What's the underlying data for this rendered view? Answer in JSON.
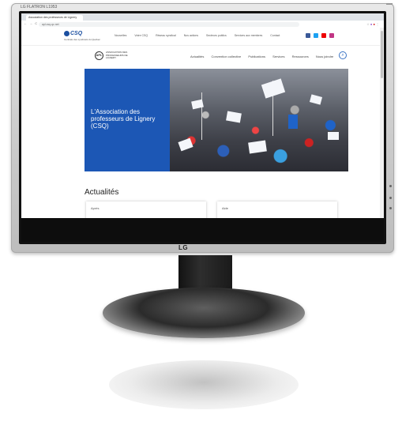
{
  "monitor": {
    "model_label": "LG FLATRON L1953",
    "top_button_label": "",
    "brand": "LG"
  },
  "browser": {
    "tab_title": "Association des professeurs de Lignery",
    "url": "apl.csq.qc.net",
    "nav_icons": "← → C ⌂"
  },
  "csq_bar": {
    "logo_text": "CSQ",
    "sub_text": "Centrale des syndicats du Québec",
    "menu": [
      "Nouvelles",
      "Votre CSQ",
      "Réseau syndical",
      "Nos actions",
      "Secteurs publics",
      "Services aux membres",
      "Contact"
    ],
    "social_icons": [
      "facebook-icon",
      "twitter-icon",
      "youtube-icon",
      "instagram-icon"
    ]
  },
  "site_header": {
    "logo_initials": "APL",
    "name": "ASSOCIATION DES PROFESSEURS DE LIGNERY",
    "menu": [
      "Actualités",
      "Convention collective",
      "Publications",
      "Services",
      "Ressources",
      "Nous joindre"
    ],
    "search_icon": "search-icon"
  },
  "hero": {
    "title": "L'Association des professeurs de Lignery (CSQ)"
  },
  "news": {
    "heading": "Actualités",
    "cards": [
      "Après",
      "Aide"
    ]
  }
}
